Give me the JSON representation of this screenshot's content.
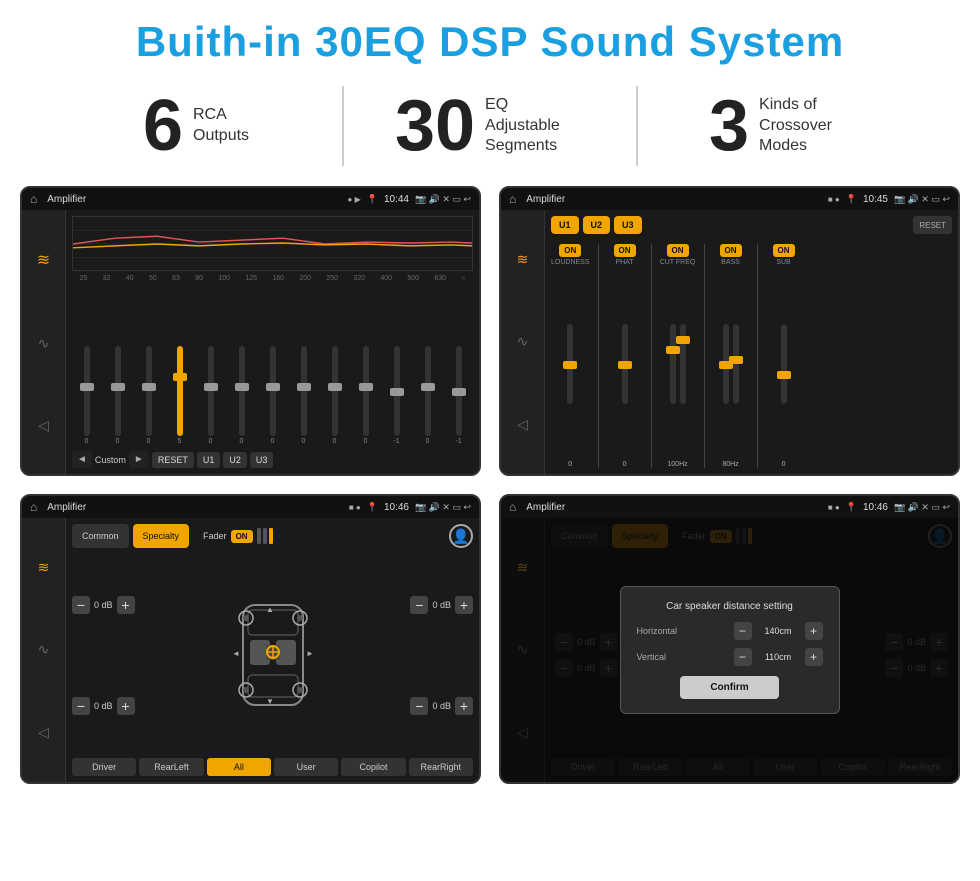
{
  "page": {
    "title": "Buith-in 30EQ DSP Sound System",
    "stats": [
      {
        "number": "6",
        "label": "RCA\nOutputs"
      },
      {
        "number": "30",
        "label": "EQ Adjustable\nSegments"
      },
      {
        "number": "3",
        "label": "Kinds of\nCrossover Modes"
      }
    ]
  },
  "screen1": {
    "status_bar": {
      "title": "Amplifier",
      "time": "10:44"
    },
    "eq_frequencies": [
      "25",
      "32",
      "40",
      "50",
      "63",
      "80",
      "100",
      "125",
      "160",
      "200",
      "250",
      "320",
      "400",
      "500",
      "630"
    ],
    "eq_values": [
      "0",
      "0",
      "0",
      "5",
      "0",
      "0",
      "0",
      "0",
      "0",
      "0",
      "-1",
      "0",
      "-1"
    ],
    "preset": "Custom",
    "buttons": [
      "RESET",
      "U1",
      "U2",
      "U3"
    ]
  },
  "screen2": {
    "status_bar": {
      "title": "Amplifier",
      "time": "10:45"
    },
    "channels": [
      "U1",
      "U2",
      "U3"
    ],
    "controls": [
      "LOUDNESS",
      "PHAT",
      "CUT FREQ",
      "BASS",
      "SUB"
    ],
    "toggles": [
      "ON",
      "ON",
      "ON",
      "ON",
      "ON"
    ],
    "reset_label": "RESET"
  },
  "screen3": {
    "status_bar": {
      "title": "Amplifier",
      "time": "10:46"
    },
    "tabs": [
      "Common",
      "Specialty"
    ],
    "fader_label": "Fader",
    "fader_state": "ON",
    "db_values": [
      "0 dB",
      "0 dB",
      "0 dB",
      "0 dB"
    ],
    "bottom_btns": [
      "Driver",
      "",
      "",
      "",
      "User",
      "RearRight"
    ],
    "all_btn": "All",
    "rear_left": "RearLeft",
    "copilot": "Copilot"
  },
  "screen4": {
    "status_bar": {
      "title": "Amplifier",
      "time": "10:46"
    },
    "tabs": [
      "Common",
      "Specialty"
    ],
    "dialog": {
      "title": "Car speaker distance setting",
      "fields": [
        {
          "label": "Horizontal",
          "value": "140cm"
        },
        {
          "label": "Vertical",
          "value": "110cm"
        }
      ],
      "confirm_label": "Confirm"
    },
    "db_values": [
      "0 dB",
      "0 dB"
    ],
    "bottom_btns": [
      "Driver",
      "RearLeft",
      "All",
      "User",
      "RearRight"
    ],
    "copilot": "Copilot"
  },
  "icons": {
    "home": "⌂",
    "back": "↩",
    "eq_main": "≡",
    "waveform": "∿",
    "volume": "◁",
    "speaker": "♪",
    "settings": "⚙",
    "minus": "−",
    "plus": "+"
  }
}
